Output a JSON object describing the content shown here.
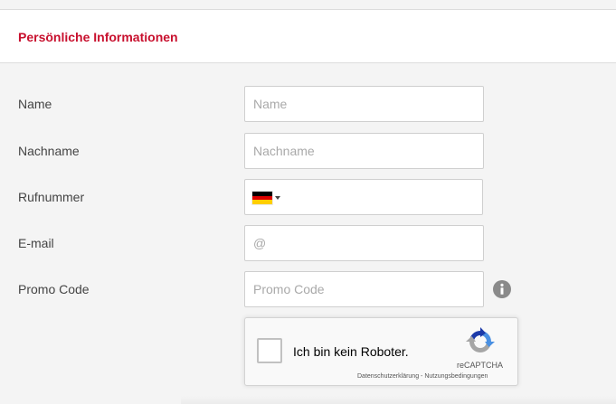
{
  "section": {
    "title": "Persönliche Informationen"
  },
  "fields": {
    "name": {
      "label": "Name",
      "placeholder": "Name",
      "value": ""
    },
    "lastname": {
      "label": "Nachname",
      "placeholder": "Nachname",
      "value": ""
    },
    "phone": {
      "label": "Rufnummer",
      "country_flag": "germany-flag-icon",
      "value": ""
    },
    "email": {
      "label": "E-mail",
      "placeholder": "@",
      "value": ""
    },
    "promo": {
      "label": "Promo Code",
      "placeholder": "Promo Code",
      "value": "",
      "help_icon": "info-icon"
    }
  },
  "recaptcha": {
    "label": "Ich bin kein Roboter.",
    "brand": "reCAPTCHA",
    "privacy_link": "Datenschutzerklärung",
    "separator": " - ",
    "terms_link": "Nutzungsbedingungen",
    "checked": false
  },
  "colors": {
    "accent": "#c8102e",
    "background": "#f4f4f4",
    "border": "#cfcfcf"
  }
}
